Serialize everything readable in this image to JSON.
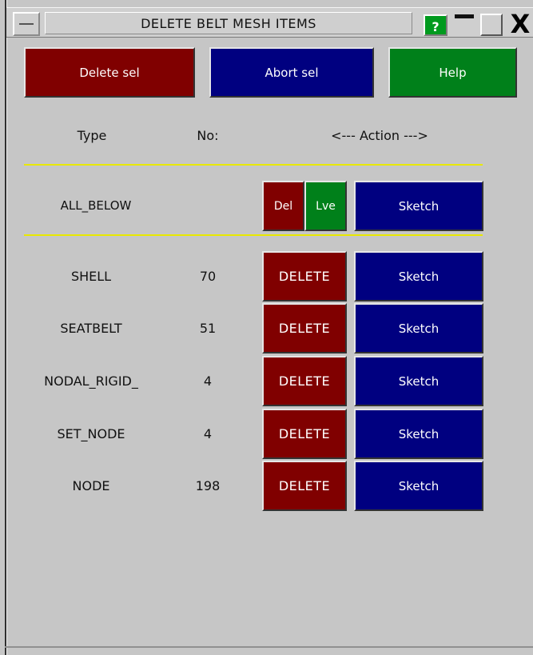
{
  "window": {
    "title": "DELETE BELT MESH ITEMS",
    "help_glyph": "?",
    "close_glyph": "X"
  },
  "toolbar": {
    "delete_sel_label": "Delete sel",
    "abort_sel_label": "Abort sel",
    "help_label": "Help"
  },
  "header": {
    "type": "Type",
    "no": "No:",
    "action": "<--- Action --->"
  },
  "all_below": {
    "label": "ALL_BELOW",
    "del_label": "Del",
    "lve_label": "Lve",
    "sketch_label": "Sketch"
  },
  "items": [
    {
      "type": "SHELL",
      "no": "70",
      "delete_label": "DELETE",
      "sketch_label": "Sketch"
    },
    {
      "type": "SEATBELT",
      "no": "51",
      "delete_label": "DELETE",
      "sketch_label": "Sketch"
    },
    {
      "type": "NODAL_RIGID_",
      "no": "4",
      "delete_label": "DELETE",
      "sketch_label": "Sketch"
    },
    {
      "type": "SET_NODE",
      "no": "4",
      "delete_label": "DELETE",
      "sketch_label": "Sketch"
    },
    {
      "type": "NODE",
      "no": "198",
      "delete_label": "DELETE",
      "sketch_label": "Sketch"
    }
  ],
  "colors": {
    "red": "#800000",
    "blue": "#000080",
    "green": "#00801a",
    "separator": "#e8e800",
    "panel": "#c6c6c6"
  }
}
